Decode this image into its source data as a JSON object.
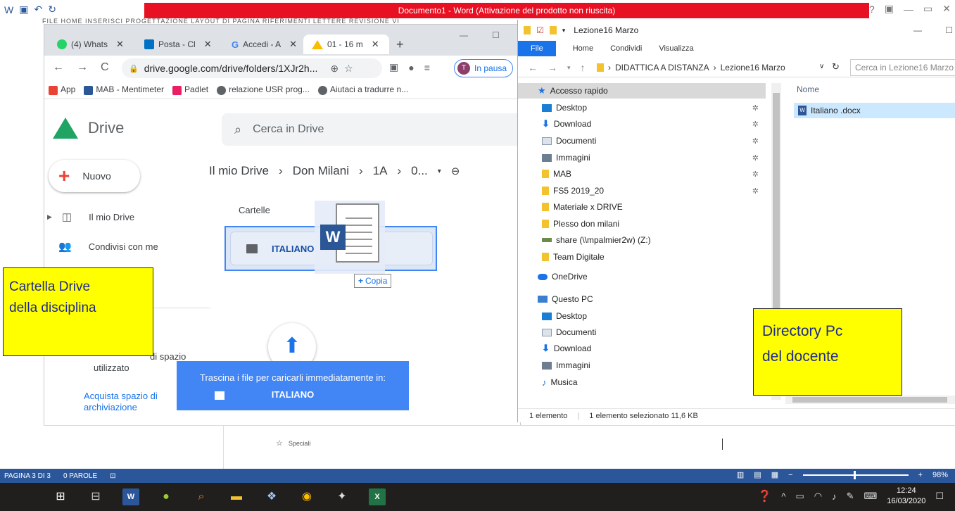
{
  "word": {
    "title": "Documento1 - Word (Attivazione del prodotto non riuscita)",
    "menu_strip": "FILE   HOME   INSERISCI   PROGETTAZIONE   LAYOUT DI PAGINA   RIFERIMENTI   LETTERE   REVISIONE   VI",
    "status_page": "PAGINA 3 DI 3",
    "status_words": "0 PAROLE",
    "zoom": "98%",
    "speciali": "Speciali"
  },
  "chrome": {
    "tabs": [
      {
        "label": "(4) Whats"
      },
      {
        "label": "Posta - Cl"
      },
      {
        "label": "Accedi - A"
      },
      {
        "label": "01 - 16 m"
      }
    ],
    "url": "drive.google.com/drive/folders/1XJr2h...",
    "profile_initial": "T",
    "profile_status": "In pausa",
    "bookmarks": [
      "App",
      "MAB - Mentimeter",
      "Padlet",
      "relazione USR prog...",
      "Aiutaci a tradurre n..."
    ]
  },
  "drive": {
    "brand": "Drive",
    "search_placeholder": "Cerca in Drive",
    "new_label": "Nuovo",
    "sidebar": [
      {
        "label": "Il mio Drive"
      },
      {
        "label": "Condivisi con me"
      }
    ],
    "storage_text": "0 byte di 15 GB di spazio utilizzato",
    "storage_line1": "di spazio",
    "storage_line2": "utilizzato",
    "buy_storage_l1": "Acquista spazio di",
    "buy_storage_l2": "archiviazione",
    "breadcrumb": [
      "Il mio Drive",
      "Don Milani",
      "1A",
      "0..."
    ],
    "folders_label": "Cartelle",
    "folder_name": "ITALIANO",
    "copy_badge": "Copia",
    "drop_line1": "Trascina i file per caricarli immediatamente in:",
    "drop_folder": "ITALIANO"
  },
  "explorer": {
    "title": "Lezione16 Marzo",
    "ribbon": [
      "File",
      "Home",
      "Condividi",
      "Visualizza"
    ],
    "path": [
      "DIDATTICA A DISTANZA",
      "Lezione16 Marzo"
    ],
    "search_placeholder": "Cerca in Lezione16 Marzo",
    "nav": [
      {
        "label": "Accesso rapido",
        "icon": "star-icon"
      },
      {
        "label": "Desktop",
        "icon": "desktop-icon"
      },
      {
        "label": "Download",
        "icon": "download-icon"
      },
      {
        "label": "Documenti",
        "icon": "documents-icon"
      },
      {
        "label": "Immagini",
        "icon": "images-icon"
      },
      {
        "label": "MAB",
        "icon": "folder-icon"
      },
      {
        "label": "FS5 2019_20",
        "icon": "folder-icon"
      },
      {
        "label": "Materiale x DRIVE",
        "icon": "folder-icon"
      },
      {
        "label": "Plesso don milani",
        "icon": "folder-icon"
      },
      {
        "label": "share (\\\\mpalmier2w) (Z:)",
        "icon": "network-drive-icon"
      },
      {
        "label": "Team Digitale",
        "icon": "folder-icon"
      },
      {
        "label": "OneDrive",
        "icon": "onedrive-icon"
      },
      {
        "label": "Questo PC",
        "icon": "pc-icon"
      },
      {
        "label": "Desktop",
        "icon": "desktop-icon"
      },
      {
        "label": "Documenti",
        "icon": "documents-icon"
      },
      {
        "label": "Download",
        "icon": "download-icon"
      },
      {
        "label": "Immagini",
        "icon": "images-icon"
      },
      {
        "label": "Musica",
        "icon": "music-icon"
      }
    ],
    "column_name": "Nome",
    "file_name": "Italiano .docx",
    "status_count": "1 elemento",
    "status_selected": "1 elemento selezionato  11,6 KB"
  },
  "callouts": {
    "drive_l1": "Cartella Drive",
    "drive_l2": "della disciplina",
    "pc_l1": "Directory Pc",
    "pc_l2": "del docente"
  },
  "taskbar": {
    "time": "12:24",
    "date": "16/03/2020"
  }
}
